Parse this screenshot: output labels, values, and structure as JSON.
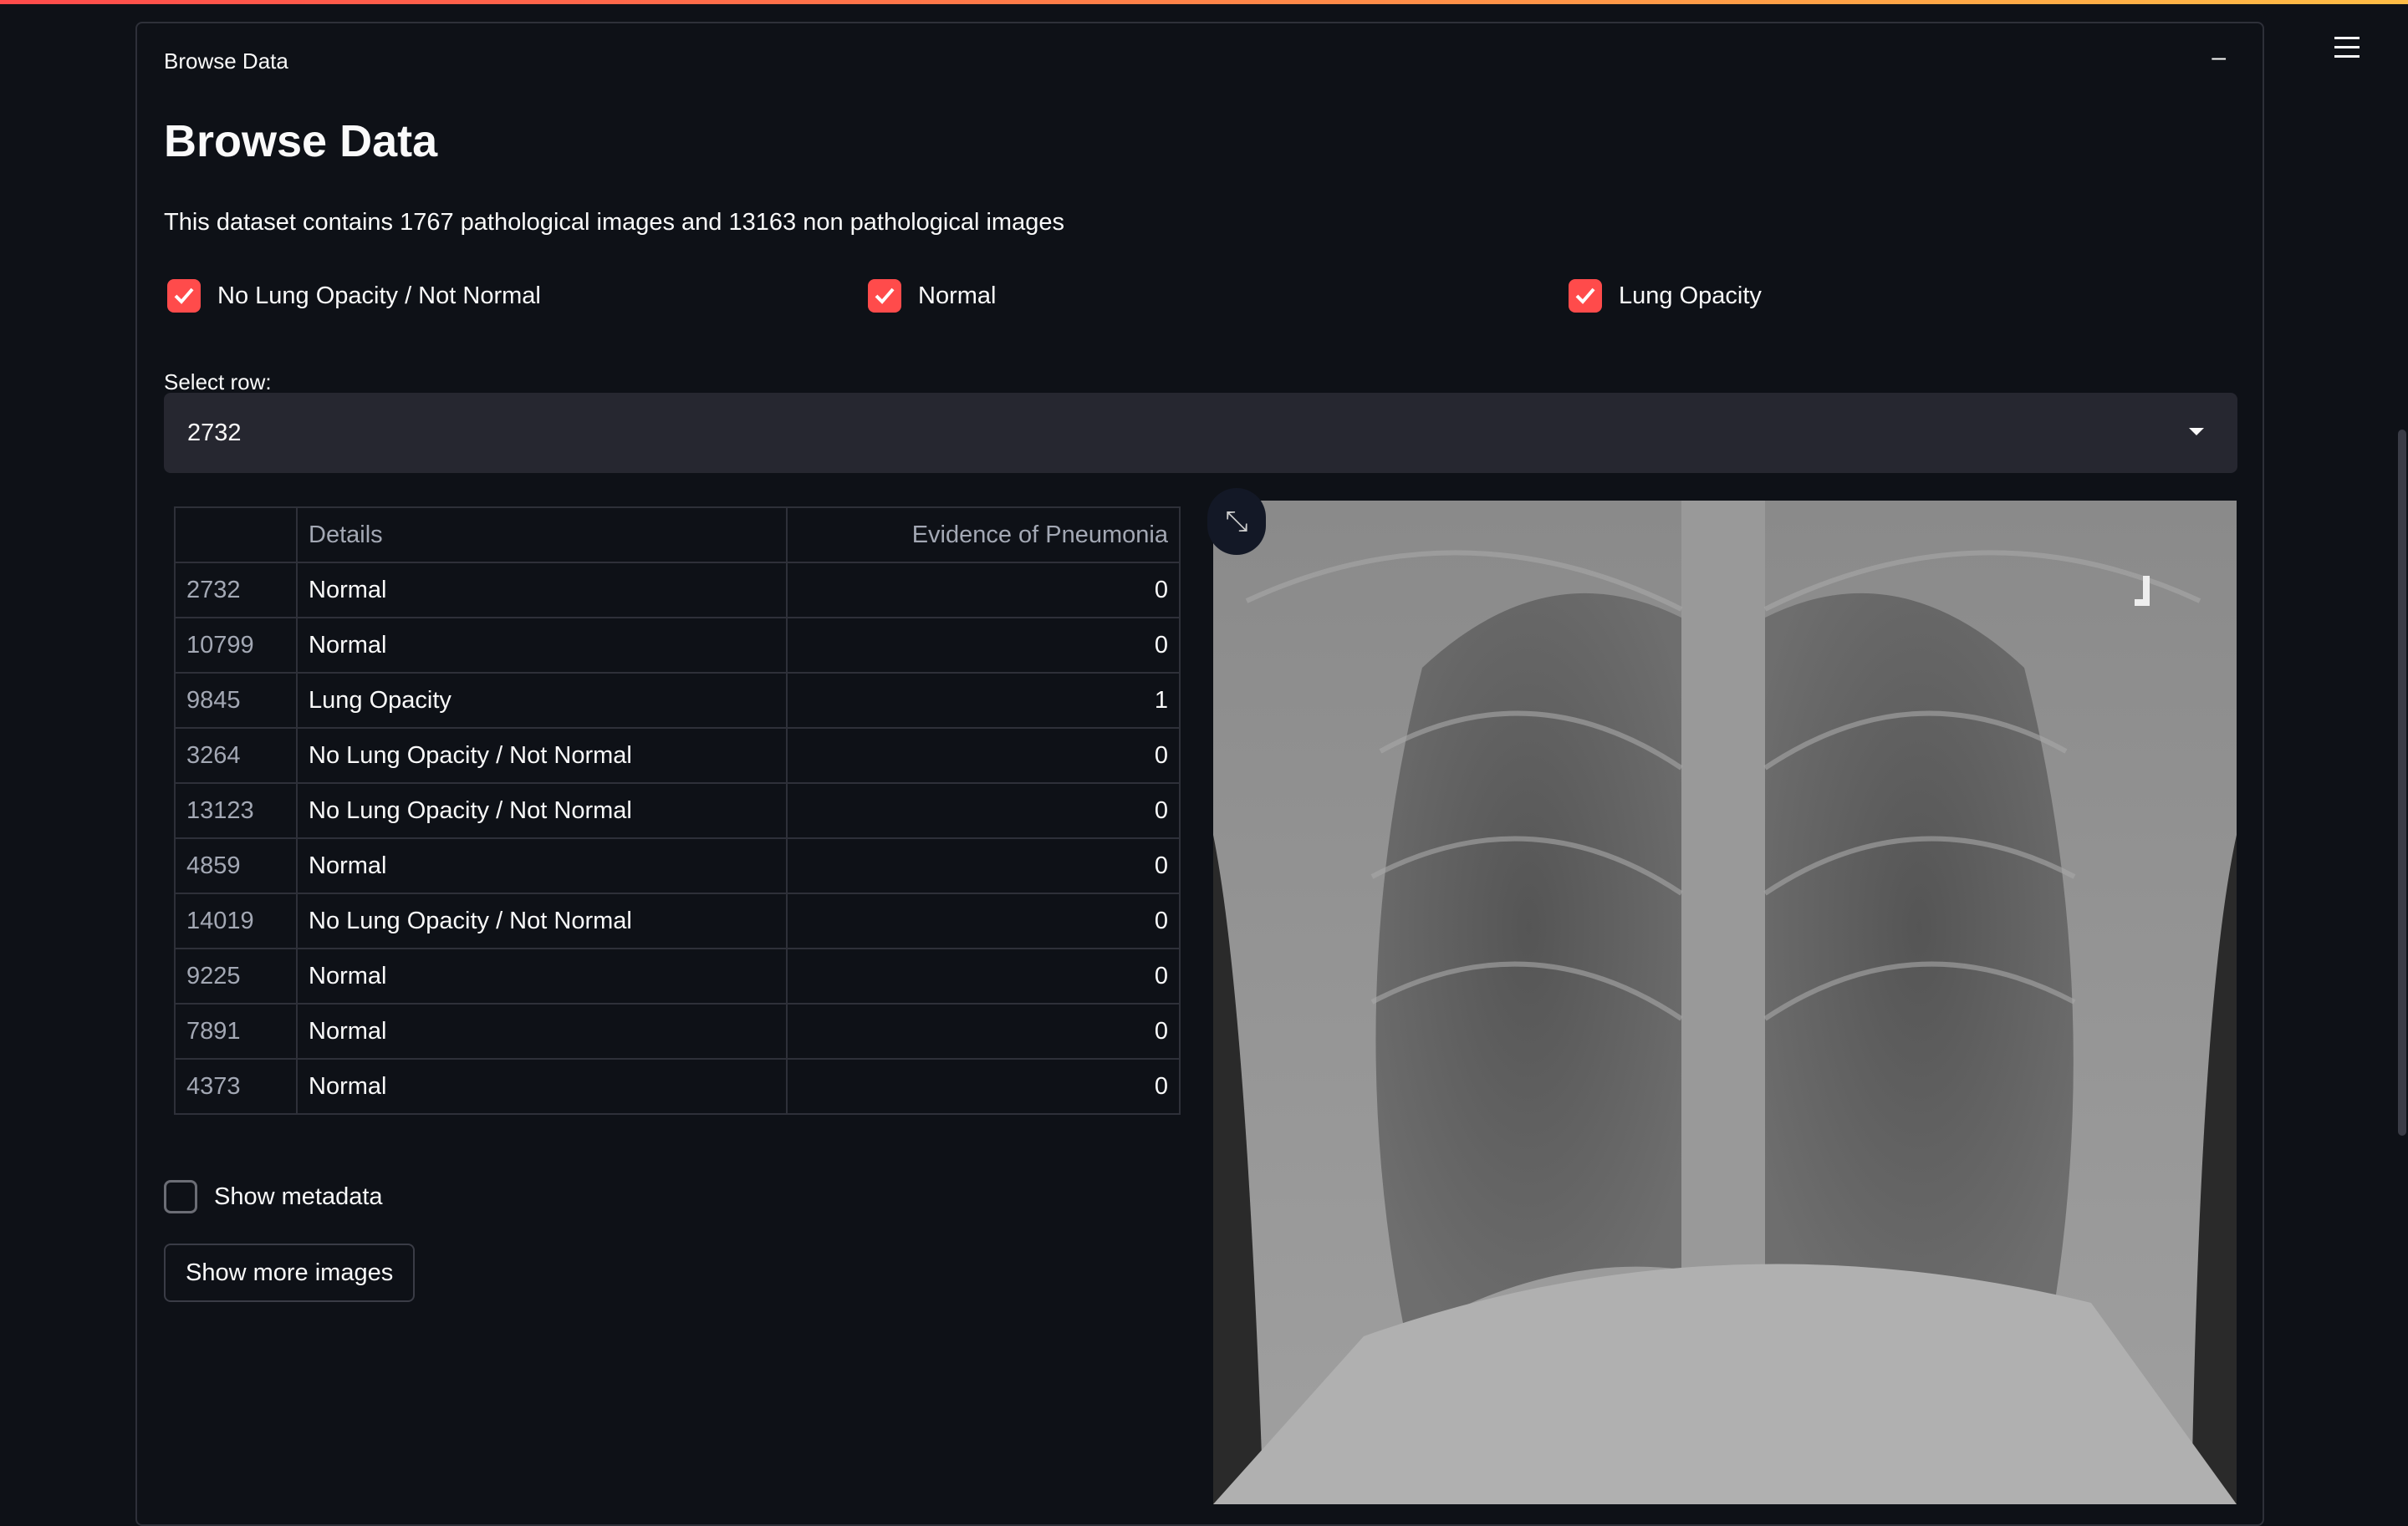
{
  "colors": {
    "accent": "#ff4b4b",
    "background": "#0e1117",
    "input_bg": "#262730"
  },
  "expander": {
    "title": "Browse Data",
    "collapse_icon": "minus-icon"
  },
  "header": {
    "title": "Browse Data",
    "description": "This dataset contains 1767 pathological images and 13163 non pathological images"
  },
  "filters": [
    {
      "label": "No Lung Opacity / Not Normal",
      "checked": true
    },
    {
      "label": "Normal",
      "checked": true
    },
    {
      "label": "Lung Opacity",
      "checked": true
    }
  ],
  "select_row": {
    "label": "Select row:",
    "value": "2732"
  },
  "table": {
    "columns": [
      "",
      "Details",
      "Evidence of Pneumonia"
    ],
    "rows": [
      [
        "2732",
        "Normal",
        "0"
      ],
      [
        "10799",
        "Normal",
        "0"
      ],
      [
        "9845",
        "Lung Opacity",
        "1"
      ],
      [
        "3264",
        "No Lung Opacity / Not Normal",
        "0"
      ],
      [
        "13123",
        "No Lung Opacity / Not Normal",
        "0"
      ],
      [
        "4859",
        "Normal",
        "0"
      ],
      [
        "14019",
        "No Lung Opacity / Not Normal",
        "0"
      ],
      [
        "9225",
        "Normal",
        "0"
      ],
      [
        "7891",
        "Normal",
        "0"
      ],
      [
        "4373",
        "Normal",
        "0"
      ]
    ]
  },
  "metadata_toggle": {
    "label": "Show metadata",
    "checked": false
  },
  "more_button": {
    "label": "Show more images"
  },
  "icons": {
    "menu": "hamburger-icon",
    "fullscreen": "expand-icon"
  }
}
